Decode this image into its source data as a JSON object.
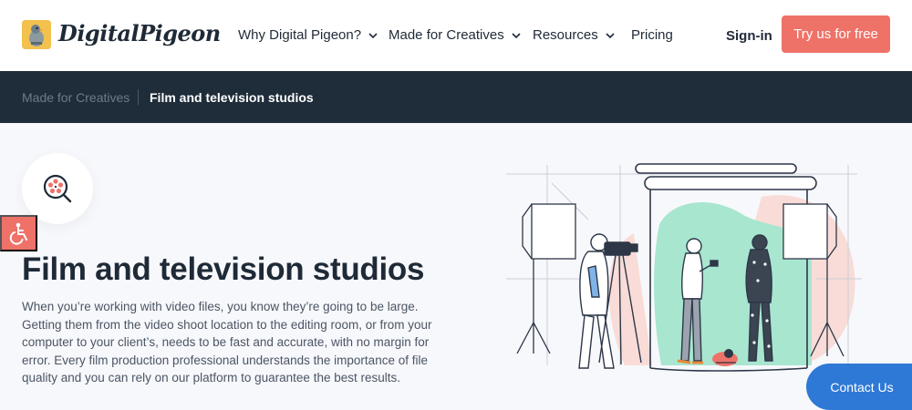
{
  "header": {
    "logo_text": "DigitalPigeon",
    "nav": [
      {
        "label": "Why Digital Pigeon?",
        "has_dropdown": true
      },
      {
        "label": "Made for Creatives",
        "has_dropdown": true
      },
      {
        "label": "Resources",
        "has_dropdown": true
      },
      {
        "label": "Pricing",
        "has_dropdown": false
      }
    ],
    "signin_label": "Sign-in",
    "cta_label": "Try us for free"
  },
  "breadcrumb": {
    "parent": "Made for Creatives",
    "current": "Film and television studios"
  },
  "hero": {
    "icon": "film-reel-icon",
    "title": "Film and television studios",
    "description": "When you’re working with video files, you know they’re going to be large. Getting them from the video shoot location to the editing room, or from your computer to your client’s, needs to be fast and accurate, with no margin for error. Every film production professional understands the importance of file quality and you can rely on our platform to guarantee the best results."
  },
  "accessibility": {
    "icon": "wheelchair-icon"
  },
  "contact_label": "Contact Us",
  "colors": {
    "accent": "#ee7268",
    "dark_bar": "#1f2d3a",
    "contact_blue": "#2f79d6",
    "mint": "#a8e6cf",
    "blush": "#f9d7d0"
  }
}
